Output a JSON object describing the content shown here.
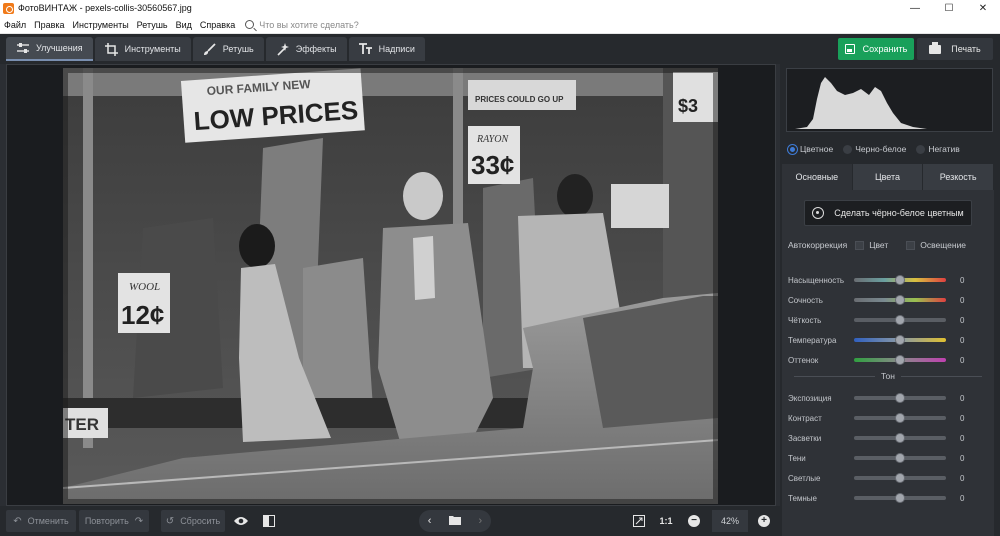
{
  "window": {
    "title": "ФотоВИНТАЖ - pexels-collis-30560567.jpg",
    "controls": {
      "minimize": "—",
      "maximize": "☐",
      "close": "✕"
    }
  },
  "menu": {
    "items": [
      "Файл",
      "Правка",
      "Инструменты",
      "Ретушь",
      "Вид",
      "Справка"
    ],
    "search_placeholder": "Что вы хотите сделать?"
  },
  "toolbar": {
    "tabs": [
      {
        "label": "Улучшения",
        "icon": "sliders-icon",
        "active": true
      },
      {
        "label": "Инструменты",
        "icon": "crop-icon",
        "active": false
      },
      {
        "label": "Ретушь",
        "icon": "brush-icon",
        "active": false
      },
      {
        "label": "Эффекты",
        "icon": "magic-wand-icon",
        "active": false
      },
      {
        "label": "Надписи",
        "icon": "text-icon",
        "active": false
      }
    ],
    "save_label": "Сохранить",
    "print_label": "Печать"
  },
  "bottombar": {
    "undo_label": "Отменить",
    "redo_label": "Повторить",
    "reset_label": "Сбросить",
    "zoom_one_to_one": "1:1",
    "zoom_value": "42%"
  },
  "panel": {
    "modes": [
      {
        "label": "Цветное",
        "selected": true
      },
      {
        "label": "Черно-белое",
        "selected": false
      },
      {
        "label": "Негатив",
        "selected": false
      }
    ],
    "subtabs": [
      {
        "label": "Основные",
        "active": true
      },
      {
        "label": "Цвета",
        "active": false
      },
      {
        "label": "Резкость",
        "active": false
      }
    ],
    "colorize_button": "Сделать чёрно-белое цветным",
    "autocorrection_label": "Автокоррекция",
    "auto_color_label": "Цвет",
    "auto_light_label": "Освещение",
    "basic_sliders": [
      {
        "label": "Насыщенность",
        "value": "0",
        "track": "saturation"
      },
      {
        "label": "Сочность",
        "value": "0",
        "track": "vibrance"
      },
      {
        "label": "Чёткость",
        "value": "0",
        "track": "plain"
      },
      {
        "label": "Температура",
        "value": "0",
        "track": "temperature"
      },
      {
        "label": "Оттенок",
        "value": "0",
        "track": "tint"
      }
    ],
    "tone_title": "Тон",
    "tone_sliders": [
      {
        "label": "Экспозиция",
        "value": "0"
      },
      {
        "label": "Контраст",
        "value": "0"
      },
      {
        "label": "Засветки",
        "value": "0"
      },
      {
        "label": "Тени",
        "value": "0"
      },
      {
        "label": "Светлые",
        "value": "0"
      },
      {
        "label": "Темные",
        "value": "0"
      }
    ],
    "slider_level": 0.5
  },
  "photo_signs": {
    "sign1": "LOW PRICES",
    "sign1_top": "OUR FAMILY NEW",
    "sign2": "RAYON",
    "sign2_price": "33¢",
    "sign3": "WOOL",
    "sign3_price": "12¢",
    "sign4": "TER",
    "sign5": "$3",
    "sign6": "PRICES COULD GO UP"
  },
  "colors": {
    "accent_save": "#19a05a",
    "radio_on": "#3e7bd6",
    "bg_dark": "#26292d"
  }
}
